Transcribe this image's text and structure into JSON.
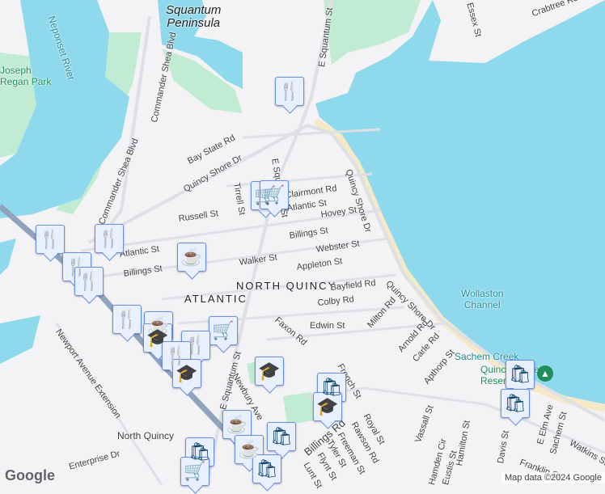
{
  "colors": {
    "water": "#8fd9ec",
    "land": "#f3f2f4",
    "park": "#c1ecd3",
    "road": "#dde1e6",
    "highway": "#8fa3bd",
    "beach": "#f5e9c8",
    "marker_bg": "#e8efff",
    "marker_icon": "#0c4466"
  },
  "places": {
    "squantum": "Squantum\nPeninsula",
    "atlantic": "ATLANTIC",
    "north_quincy": "NORTH QUINCY",
    "north_quincy_station": "North Quincy"
  },
  "water": {
    "neponset": "Neponset River",
    "wollaston": "Wollaston\nChannel"
  },
  "parks": {
    "regan": "Joseph\nRegan Park",
    "sachem": "Sachem Creek",
    "reservation": "Quincy Shore\nReservation"
  },
  "streets": [
    "Commander Shea Blvd",
    "Commander Shea Blvd",
    "E Squantum St",
    "Crabtree Rd",
    "Essex St",
    "Bay State Rd",
    "Quincy Shore Dr",
    "Tirrell St",
    "E Squantum St",
    "Russell St",
    "Atlantic St",
    "Hovey St",
    "Billings St",
    "Atlantic St",
    "Billings St",
    "Walker St",
    "Webster St",
    "Appleton St",
    "Quincy Shore Dr",
    "Bayfield Rd",
    "Colby Rd",
    "Milton Rd",
    "Edwin St",
    "Faxon Rd",
    "Quincy Shore Dr",
    "Arnold Rd",
    "Carle Rd",
    "Apthorp St",
    "Newport Avenue Extension",
    "E Squantum St",
    "Newbury Ave",
    "French St",
    "Royal St",
    "Rawson Rd",
    "Freeman St",
    "Tyler St",
    "Billings Rd",
    "Flynt St",
    "Lunt St",
    "Vassall St",
    "Hamden Cir",
    "Eustis St",
    "Hamilton St",
    "Davis St",
    "E Elm Ave",
    "Sachem St",
    "Watkins St",
    "Franklin St",
    "Enterprise Dr",
    "Clairmont Rd"
  ],
  "markers": [
    {
      "type": "restaurant",
      "icon": "🍴"
    },
    {
      "type": "grocery",
      "icon": "🛒"
    },
    {
      "type": "grocery",
      "icon": "🛒"
    },
    {
      "type": "restaurant",
      "icon": "🍴"
    },
    {
      "type": "restaurant",
      "icon": "🍴"
    },
    {
      "type": "restaurant",
      "icon": "🍴"
    },
    {
      "type": "restaurant",
      "icon": "🍴"
    },
    {
      "type": "cafe",
      "icon": "☕"
    },
    {
      "type": "restaurant",
      "icon": "🍴"
    },
    {
      "type": "cafe",
      "icon": "☕"
    },
    {
      "type": "school",
      "icon": "🎓"
    },
    {
      "type": "grocery",
      "icon": "🛒"
    },
    {
      "type": "restaurant",
      "icon": "🍴"
    },
    {
      "type": "restaurant",
      "icon": "🍴"
    },
    {
      "type": "school",
      "icon": "🎓"
    },
    {
      "type": "school",
      "icon": "🎓"
    },
    {
      "type": "shopping",
      "icon": "🛍"
    },
    {
      "type": "school",
      "icon": "🎓"
    },
    {
      "type": "cafe",
      "icon": "☕"
    },
    {
      "type": "cafe",
      "icon": "☕"
    },
    {
      "type": "shopping",
      "icon": "🛍"
    },
    {
      "type": "shopping",
      "icon": "🛍"
    },
    {
      "type": "grocery",
      "icon": "🛒"
    },
    {
      "type": "shopping",
      "icon": "🛍"
    },
    {
      "type": "shopping",
      "icon": "🛍"
    }
  ],
  "footer": {
    "logo": "Google",
    "attribution": "Map data ©2024 Google"
  }
}
